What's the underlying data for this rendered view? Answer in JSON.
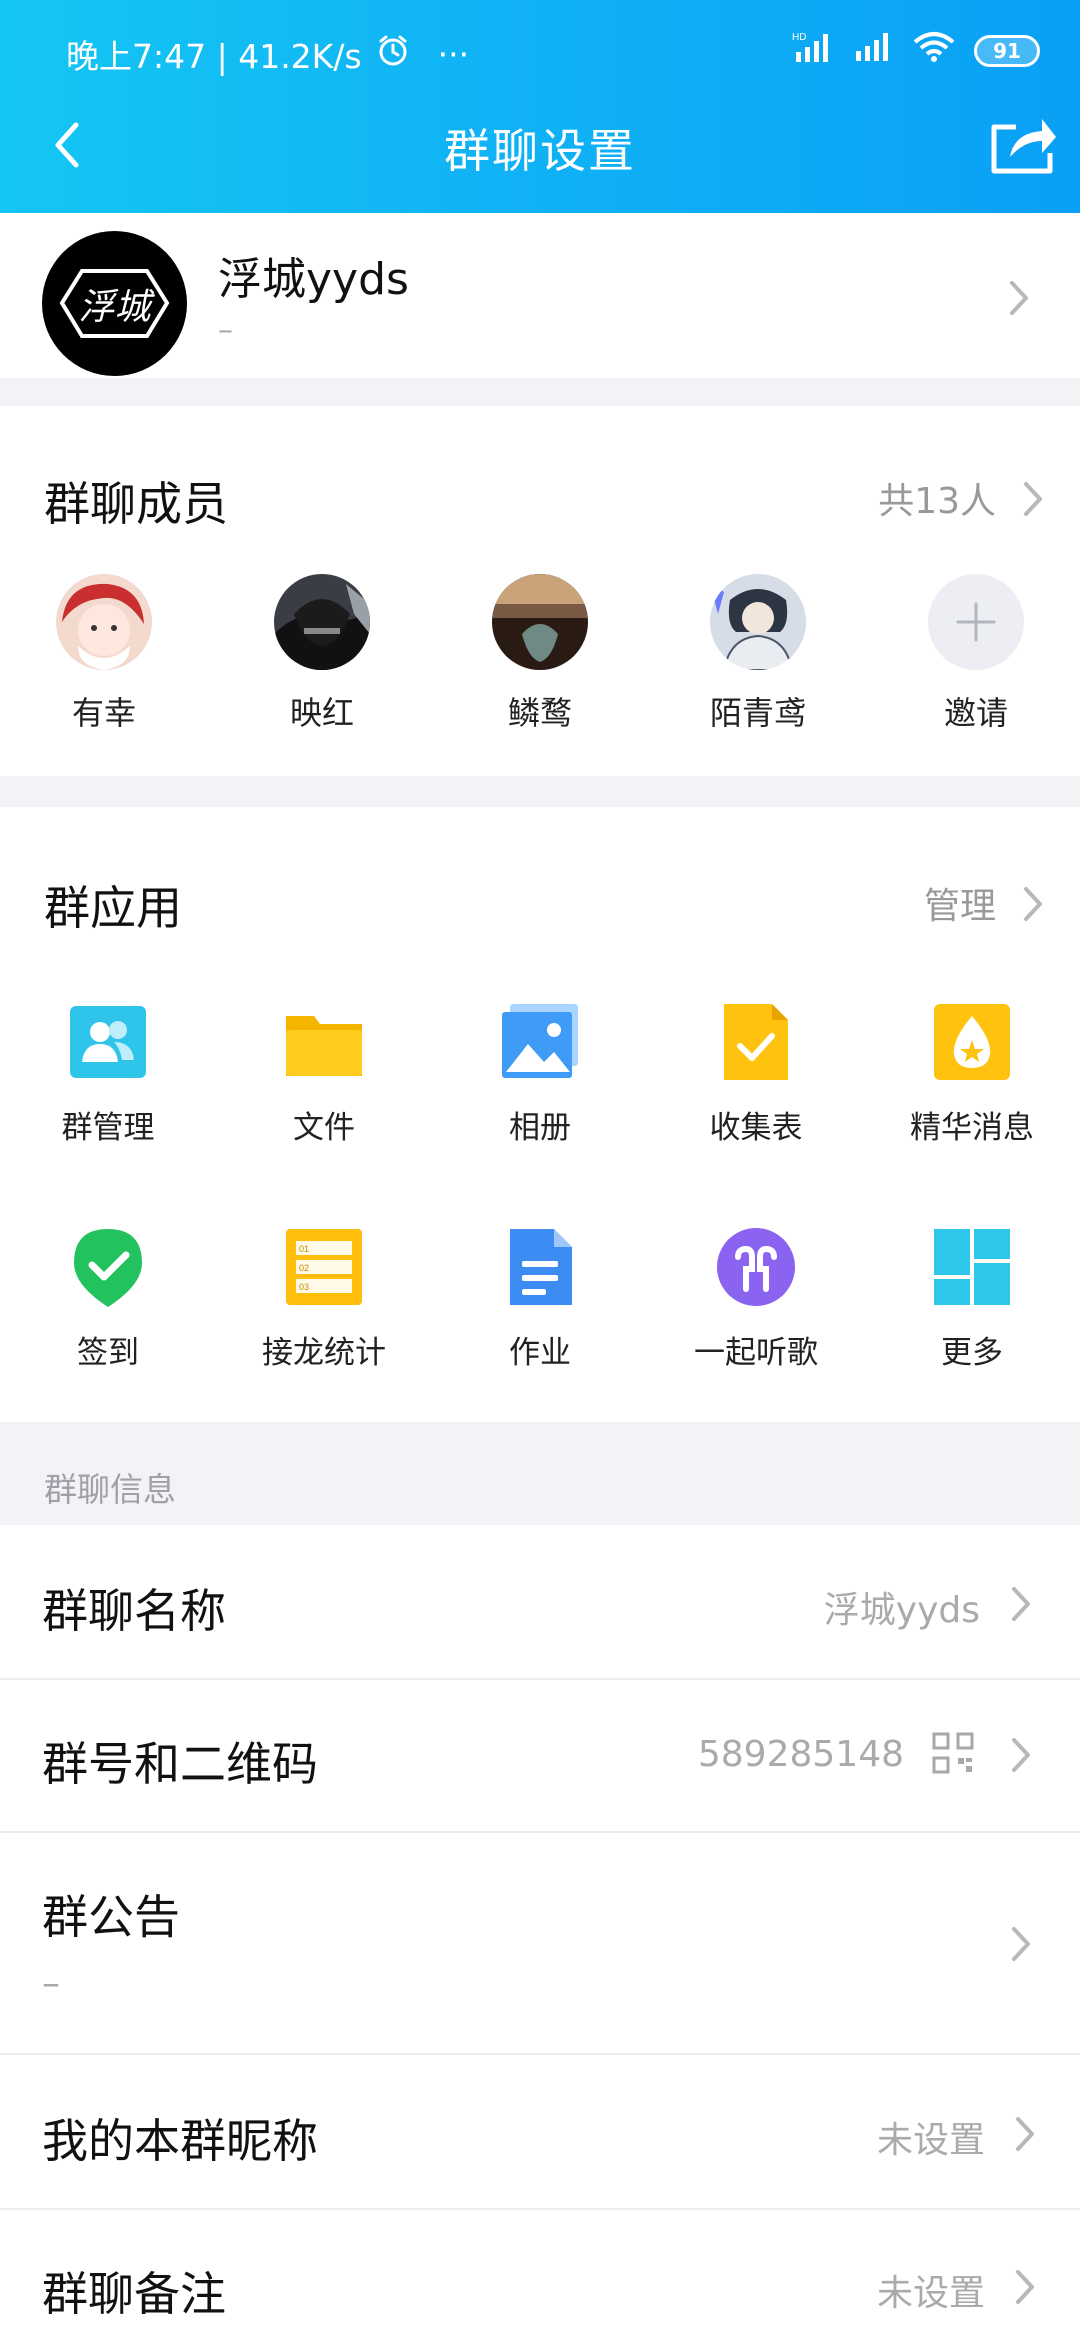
{
  "status_bar": {
    "time_text": "晚上7:47 | 41.2K/s",
    "more": "···",
    "battery": "91"
  },
  "nav": {
    "title": "群聊设置"
  },
  "group": {
    "name": "浮城yyds",
    "subtitle": "–",
    "avatar_text": "浮城"
  },
  "members": {
    "title": "群聊成员",
    "count": "共13人",
    "list": [
      {
        "name": "有幸"
      },
      {
        "name": "映红"
      },
      {
        "name": "鳞鹜"
      },
      {
        "name": "陌青鸢"
      }
    ],
    "invite_label": "邀请"
  },
  "apps": {
    "title": "群应用",
    "manage": "管理",
    "items": [
      {
        "label": "群管理",
        "icon": "group-manage-icon"
      },
      {
        "label": "文件",
        "icon": "folder-icon"
      },
      {
        "label": "相册",
        "icon": "photo-album-icon"
      },
      {
        "label": "收集表",
        "icon": "collection-form-icon"
      },
      {
        "label": "精华消息",
        "icon": "featured-message-icon"
      },
      {
        "label": "签到",
        "icon": "check-in-icon"
      },
      {
        "label": "接龙统计",
        "icon": "relay-stats-icon"
      },
      {
        "label": "作业",
        "icon": "homework-icon"
      },
      {
        "label": "一起听歌",
        "icon": "listen-together-icon"
      },
      {
        "label": "更多",
        "icon": "more-apps-icon"
      }
    ]
  },
  "info": {
    "section_label": "群聊信息",
    "group_name_label": "群聊名称",
    "group_name_value": "浮城yyds",
    "group_number_label": "群号和二维码",
    "group_number_value": "589285148",
    "announcement_label": "群公告",
    "announcement_value": "–",
    "my_nickname_label": "我的本群昵称",
    "my_nickname_value": "未设置",
    "remark_label": "群聊备注",
    "remark_value": "未设置"
  },
  "colors": {
    "header_gradient_start": "#14c6f3",
    "header_gradient_end": "#0aa0f5",
    "section_gap": "#f2f3f7"
  }
}
